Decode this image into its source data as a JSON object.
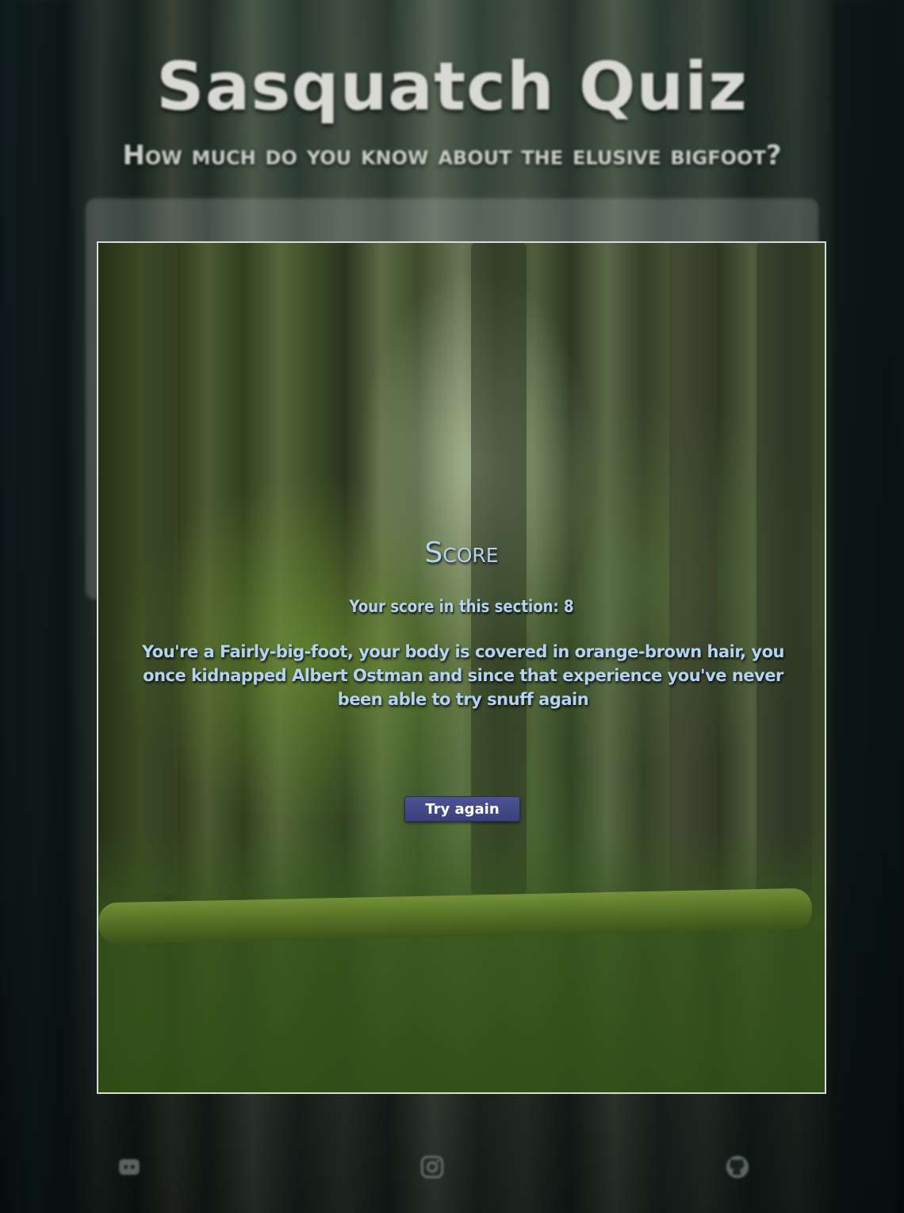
{
  "header": {
    "title": "Sasquatch Quiz",
    "subtitle": "How much do you know about the elusive bigfoot?"
  },
  "score_modal": {
    "heading": "Score",
    "score_line": "Your score in this section: 8",
    "verdict": "You're a Fairly-big-foot, your body is covered in orange-brown hair, you once kidnapped Albert Ostman and since that experience you've never been able to try snuff again",
    "try_again_label": "Try again"
  },
  "footer": {
    "icons": [
      "discord-icon",
      "instagram-icon",
      "github-icon"
    ]
  },
  "colors": {
    "score_text": "#b4d2f2",
    "button_bg": "#3f4580",
    "title_text": "#d9d9d4"
  }
}
